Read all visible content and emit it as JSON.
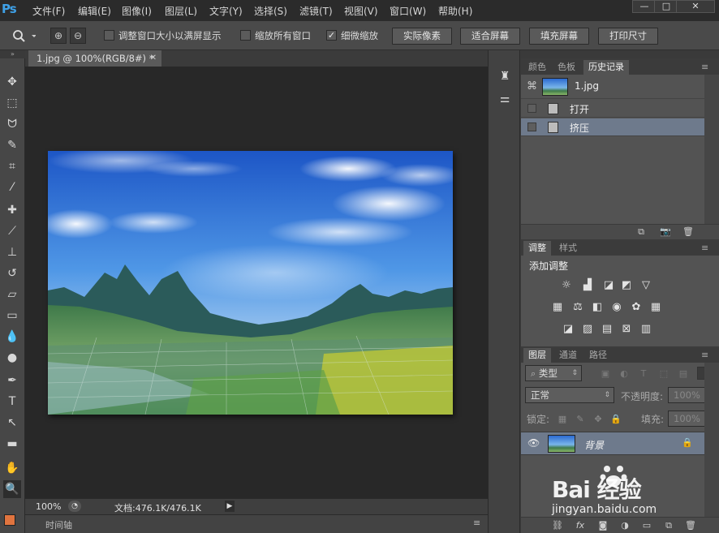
{
  "app": {
    "logo": "Ps"
  },
  "menu": [
    "文件(F)",
    "编辑(E)",
    "图像(I)",
    "图层(L)",
    "文字(Y)",
    "选择(S)",
    "滤镜(T)",
    "视图(V)",
    "窗口(W)",
    "帮助(H)"
  ],
  "window_controls": {
    "minimize": "—",
    "restore": "□",
    "close": "✕"
  },
  "options": {
    "resize_windows": {
      "label": "调整窗口大小以满屏显示",
      "checked": false
    },
    "zoom_all": {
      "label": "缩放所有窗口",
      "checked": false
    },
    "scrubby_zoom": {
      "label": "细微缩放",
      "checked": true
    },
    "buttons": [
      "实际像素",
      "适合屏幕",
      "填充屏幕",
      "打印尺寸"
    ]
  },
  "document": {
    "tab_title": "1.jpg @ 100%(RGB/8#) *",
    "zoom": "100%",
    "doc_size": "文档:476.1K/476.1K"
  },
  "timeline": {
    "label": "时间轴"
  },
  "panels": {
    "top_tabs": [
      "颜色",
      "色板",
      "历史记录"
    ],
    "history": {
      "snapshot": "1.jpg",
      "states": [
        "打开",
        "挤压"
      ]
    },
    "adjust_tabs": [
      "调整",
      "样式"
    ],
    "adjust_title": "添加调整",
    "layer_tabs": [
      "图层",
      "通道",
      "路径"
    ],
    "layers": {
      "filter_kind": "类型",
      "blend_mode": "正常",
      "opacity_label": "不透明度:",
      "opacity": "100%",
      "lock_label": "锁定:",
      "fill_label": "填充:",
      "fill": "100%",
      "items": [
        {
          "name": "背景",
          "visible": true,
          "locked": true
        }
      ]
    }
  },
  "watermark": {
    "brand": "Bai 经验",
    "url": "jingyan.baidu.com"
  },
  "colors": {
    "foreground": "#e0743f",
    "background": "#ffffff",
    "accent": "#3fa1e8"
  }
}
